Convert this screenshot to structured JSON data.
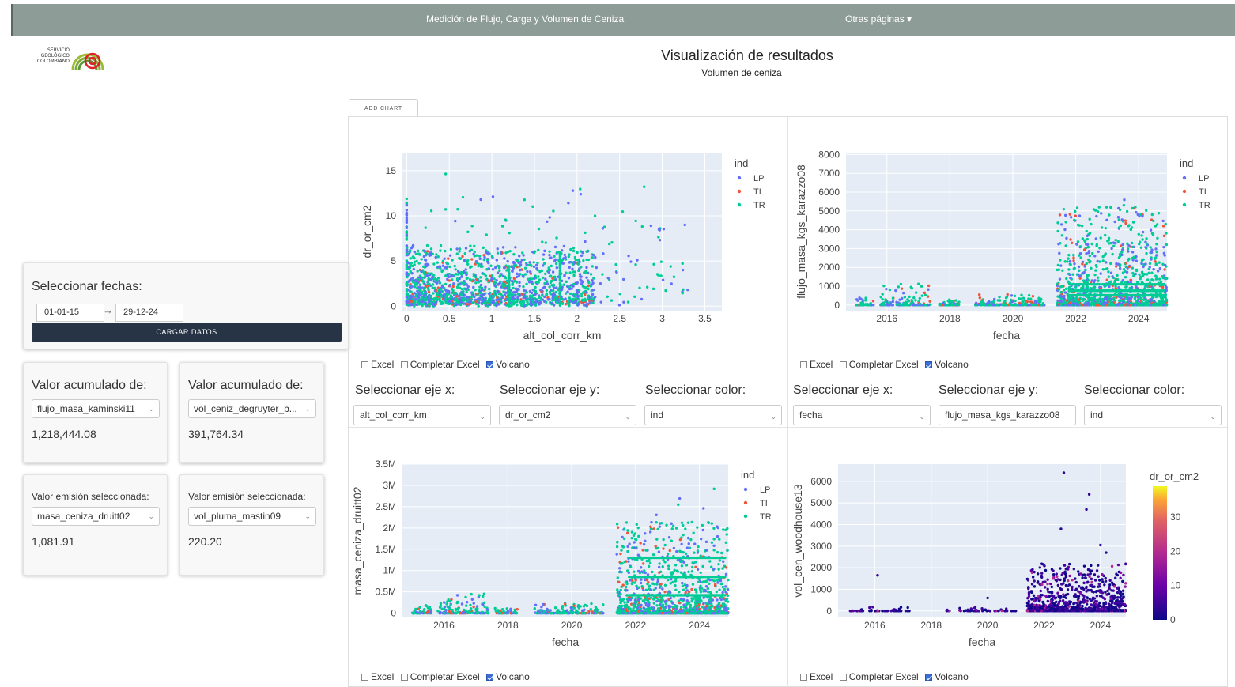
{
  "nav": {
    "title": "Medición de Flujo, Carga y Volumen de Ceniza",
    "menu": "Otras páginas ▾"
  },
  "logo": {
    "line1": "SERVICIO",
    "line2": "GEOLÓGICO",
    "line3": "COLOMBIANO"
  },
  "header": {
    "title": "Visualización de resultados",
    "subtitle": "Volumen de ceniza"
  },
  "add_chart_label": "ADD CHART",
  "dates": {
    "label": "Seleccionar fechas:",
    "start": "01-01-15",
    "end": "29-12-24",
    "load_label": "CARGAR DATOS"
  },
  "accum_cards": [
    {
      "label": "Valor acumulado de:",
      "select": "flujo_masa_kaminski11",
      "value": "1,218,444.08"
    },
    {
      "label": "Valor acumulado de:",
      "select": "vol_ceniz_degruyter_b...",
      "value": "391,764.34"
    }
  ],
  "emission_cards": [
    {
      "label": "Valor emisión seleccionada:",
      "select": "masa_ceniza_druitt02",
      "value": "1,081.91"
    },
    {
      "label": "Valor emisión seleccionada:",
      "select": "vol_pluma_mastin09",
      "value": "220.20"
    }
  ],
  "options": {
    "excel": "Excel",
    "complete": "Completar Excel",
    "volcano": "Volcano"
  },
  "selectors": {
    "x_label": "Seleccionar eje x:",
    "y_label": "Seleccionar eje y:",
    "color_label": "Seleccionar color:"
  },
  "panels": [
    {
      "x_select": "alt_col_corr_km",
      "y_select": "dr_or_cm2",
      "color_select": "ind"
    },
    {
      "x_select": "fecha",
      "y_select": "flujo_masa_kgs_karazzo08",
      "color_select": "ind"
    }
  ],
  "colors": {
    "LP": "#636efa",
    "TI": "#ef553b",
    "TR": "#00cc96",
    "plot_bg": "#e5ecf6",
    "nav_bg": "#8e9c98",
    "button_bg": "#273445"
  },
  "chart_data": [
    {
      "type": "scatter",
      "xlabel": "alt_col_corr_km",
      "ylabel": "dr_or_cm2",
      "legend_title": "ind",
      "series": [
        {
          "name": "LP"
        },
        {
          "name": "TI"
        },
        {
          "name": "TR"
        }
      ],
      "xticks": [
        "0",
        "0.5",
        "1",
        "1.5",
        "2",
        "2.5",
        "3",
        "3.5"
      ],
      "yticks": [
        "0",
        "5",
        "10",
        "15"
      ],
      "xlim": [
        -0.05,
        3.7
      ],
      "ylim": [
        -0.5,
        17
      ]
    },
    {
      "type": "scatter",
      "xlabel": "fecha",
      "ylabel": "flujo_masa_kgs_karazzo08",
      "legend_title": "ind",
      "series": [
        {
          "name": "LP"
        },
        {
          "name": "TI"
        },
        {
          "name": "TR"
        }
      ],
      "xticks": [
        "2016",
        "2018",
        "2020",
        "2022",
        "2024"
      ],
      "yticks": [
        "0",
        "1000",
        "2000",
        "3000",
        "4000",
        "5000",
        "6000",
        "7000",
        "8000"
      ],
      "xlim": [
        2014.7,
        2024.9
      ],
      "ylim": [
        -300,
        8100
      ]
    },
    {
      "type": "scatter",
      "xlabel": "fecha",
      "ylabel": "masa_ceniza_druitt02",
      "legend_title": "ind",
      "series": [
        {
          "name": "LP"
        },
        {
          "name": "TI"
        },
        {
          "name": "TR"
        }
      ],
      "xticks": [
        "2016",
        "2018",
        "2020",
        "2022",
        "2024"
      ],
      "yticks": [
        "0",
        "0.5M",
        "1M",
        "1.5M",
        "2M",
        "2.5M",
        "3M",
        "3.5M"
      ],
      "xlim": [
        2014.7,
        2024.9
      ],
      "ylim": [
        -100000,
        3500000
      ]
    },
    {
      "type": "scatter",
      "xlabel": "fecha",
      "ylabel": "vol_cen_woodhouse13",
      "colorbar_title": "dr_or_cm2",
      "colorbar_ticks": [
        "0",
        "10",
        "20",
        "30"
      ],
      "xticks": [
        "2016",
        "2018",
        "2020",
        "2022",
        "2024"
      ],
      "yticks": [
        "0",
        "1000",
        "2000",
        "3000",
        "4000",
        "5000",
        "6000"
      ],
      "xlim": [
        2014.7,
        2024.9
      ],
      "ylim": [
        -300,
        6800
      ]
    }
  ]
}
